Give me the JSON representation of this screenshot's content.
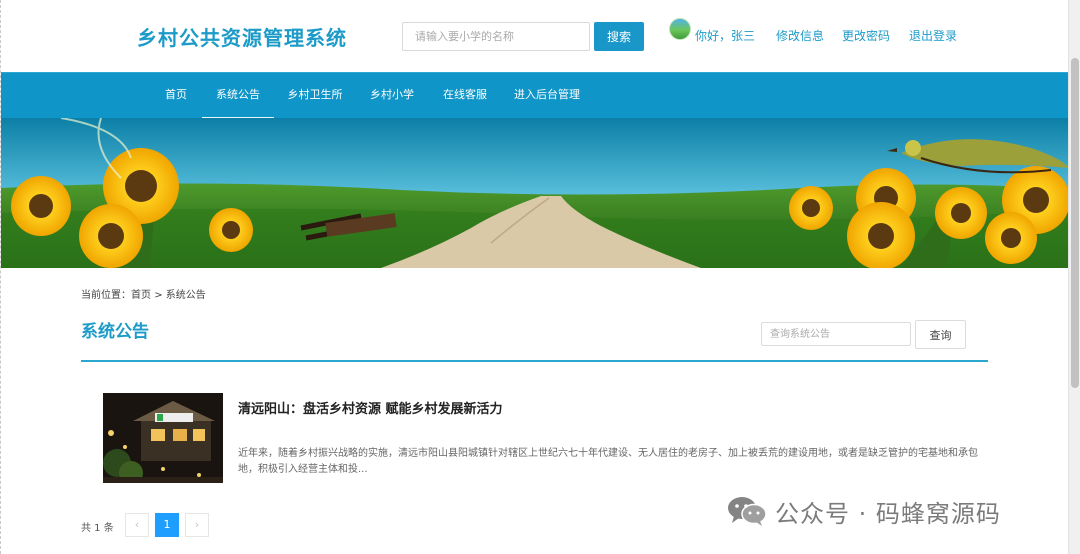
{
  "header": {
    "brand": "乡村公共资源管理系统",
    "search_placeholder": "请输入要小学的名称",
    "search_button": "搜索",
    "greeting": "你好，张三",
    "edit_info": "修改信息",
    "change_password": "更改密码",
    "logout": "退出登录"
  },
  "nav": {
    "items": [
      {
        "label": "首页"
      },
      {
        "label": "系统公告"
      },
      {
        "label": "乡村卫生所"
      },
      {
        "label": "乡村小学"
      },
      {
        "label": "在线客服"
      },
      {
        "label": "进入后台管理"
      }
    ],
    "active_index": 1
  },
  "breadcrumb": {
    "prefix": "当前位置：",
    "home": "首页",
    "separator": ">",
    "current": "系统公告"
  },
  "section": {
    "title": "系统公告",
    "search_placeholder": "查询系统公告",
    "search_button": "查询"
  },
  "news": [
    {
      "title": "清远阳山：盘活乡村资源 赋能乡村发展新活力",
      "summary": "近年来，随着乡村振兴战略的实施，清远市阳山县阳城镇针对辖区上世纪六七十年代建设、无人居住的老房子、加上被丢荒的建设用地，或者是缺乏管护的宅基地和承包地，积极引入经营主体和投..."
    }
  ],
  "pagination": {
    "total_text": "共 1 条",
    "prev": "‹",
    "current": "1",
    "next": "›"
  },
  "watermark": {
    "text": "公众号 · 码蜂窝源码"
  },
  "colors": {
    "brand": "#1d9bc8",
    "nav_bg": "#0f95c7",
    "button": "#1a97c9",
    "page_active": "#1e9fff"
  }
}
